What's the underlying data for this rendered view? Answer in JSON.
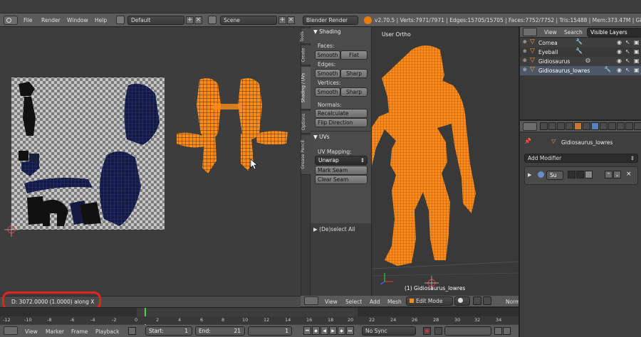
{
  "info_header": {
    "menus": [
      "File",
      "Render",
      "Window",
      "Help"
    ],
    "screen_layout": "Default",
    "scene": "Scene",
    "render_engine": "Blender Render",
    "stats": "v2.70.5 | Verts:7971/7971 | Edges:15705/15705 | Faces:7752/7752 | Tris:15488 | Mem:373.47M | Gidiosaurus_lowres"
  },
  "uv_editor": {
    "status_text": "D: 3072.0000 (1.0000) along X"
  },
  "viewport": {
    "label": "User Ortho",
    "object_label": "(1) Gidiosaurus_lowres",
    "menus": [
      "View",
      "Select",
      "Add",
      "Mesh"
    ],
    "mode": "Edit Mode",
    "shading_label": "Norm"
  },
  "toolshelf": {
    "tabs": [
      "Tools",
      "Create",
      "Shading / UVs",
      "Options",
      "Grease Pencil"
    ],
    "shading_title": "Shading",
    "faces_label": "Faces:",
    "edges_label": "Edges:",
    "vertices_label": "Vertices:",
    "normals_label": "Normals:",
    "smooth": "Smooth",
    "flat": "Flat",
    "sharp": "Sharp",
    "recalculate": "Recalculate",
    "flip_direction": "Flip Direction",
    "uvs_title": "UVs",
    "uv_mapping_label": "UV Mapping:",
    "unwrap": "Unwrap",
    "mark_seam": "Mark Seam",
    "clear_seam": "Clear Seam",
    "deselect_all": "(De)select All"
  },
  "outliner": {
    "tabs": [
      "View",
      "Search"
    ],
    "filter": "Visible Layers",
    "items": [
      {
        "name": "Cornea"
      },
      {
        "name": "Eyeball"
      },
      {
        "name": "Gidiosaurus"
      },
      {
        "name": "Gidiosaurus_lowres"
      }
    ]
  },
  "properties": {
    "object_name": "Gidiosaurus_lowres",
    "add_modifier": "Add Modifier",
    "modifier_name": "Su"
  },
  "timeline": {
    "ruler": [
      "-12",
      "-10",
      "-8",
      "-6",
      "-4",
      "-2",
      "0",
      "2",
      "4",
      "6",
      "8",
      "10",
      "12",
      "14",
      "16",
      "18",
      "20",
      "22",
      "24",
      "26",
      "28",
      "30",
      "32",
      "34"
    ],
    "menus": [
      "View",
      "Marker",
      "Frame",
      "Playback"
    ],
    "start_label": "Start:",
    "start_value": "1",
    "end_label": "End:",
    "end_value": "21",
    "current_frame": "1",
    "sync": "No Sync"
  },
  "colors": {
    "accent_orange": "#ff8c1a",
    "selection_blue": "#5680c2",
    "highlight_red": "#e8231f"
  }
}
